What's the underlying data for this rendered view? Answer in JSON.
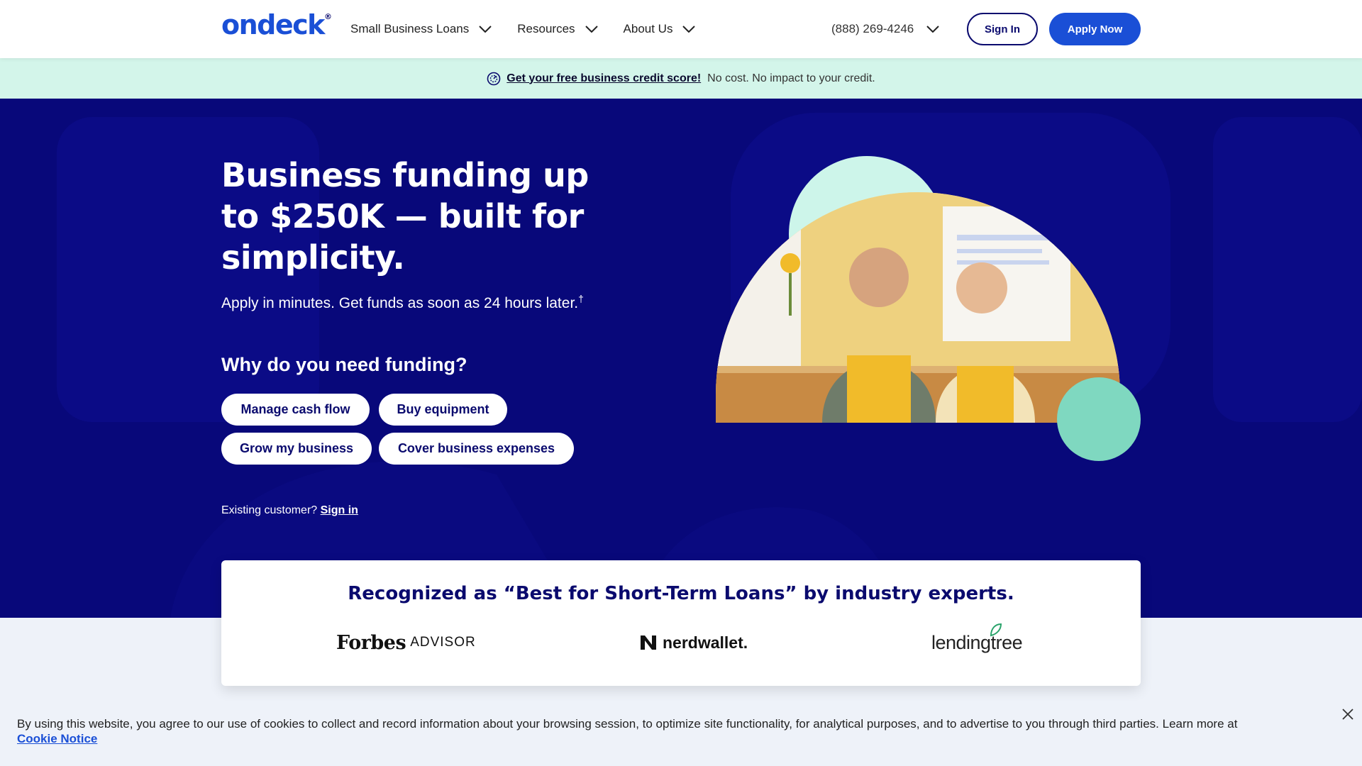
{
  "header": {
    "logo_text": "ondeck",
    "logo_mark": "®",
    "nav": [
      {
        "label": "Small Business Loans"
      },
      {
        "label": "Resources"
      },
      {
        "label": "About Us"
      }
    ],
    "phone": "(888) 269-4246",
    "sign_in_label": "Sign In",
    "apply_label": "Apply Now"
  },
  "promo": {
    "link_text": "Get your free business credit score!",
    "text": "No cost. No impact to your credit."
  },
  "hero": {
    "headline": "Business funding up to $250K — built for simplicity.",
    "subtext": "Apply in minutes. Get funds as soon as 24 hours later.",
    "subtext_mark": "†",
    "question": "Why do you need funding?",
    "chips": [
      {
        "label": "Manage cash flow"
      },
      {
        "label": "Buy equipment"
      },
      {
        "label": "Grow my business"
      },
      {
        "label": "Cover business expenses"
      }
    ],
    "existing_text": "Existing customer?",
    "existing_link": "Sign in"
  },
  "recognition": {
    "title": "Recognized as “Best for Short-Term Loans” by industry experts.",
    "partners": {
      "forbes": "Forbes",
      "forbes_sub": "ADVISOR",
      "nerdwallet": "nerdwallet.",
      "lendingtree": "lendingtree"
    }
  },
  "cookie": {
    "text": "By using this website, you agree to our use of cookies to collect and record information about your browsing session, to optimize site functionality, for analytical purposes, and to advertise to you through third parties. Learn more at",
    "link": "Cookie Notice"
  },
  "colors": {
    "brand_blue": "#1a4fd6",
    "navy": "#08087a",
    "mint": "#7fd8c0",
    "mint_light": "#d3f5ea"
  }
}
